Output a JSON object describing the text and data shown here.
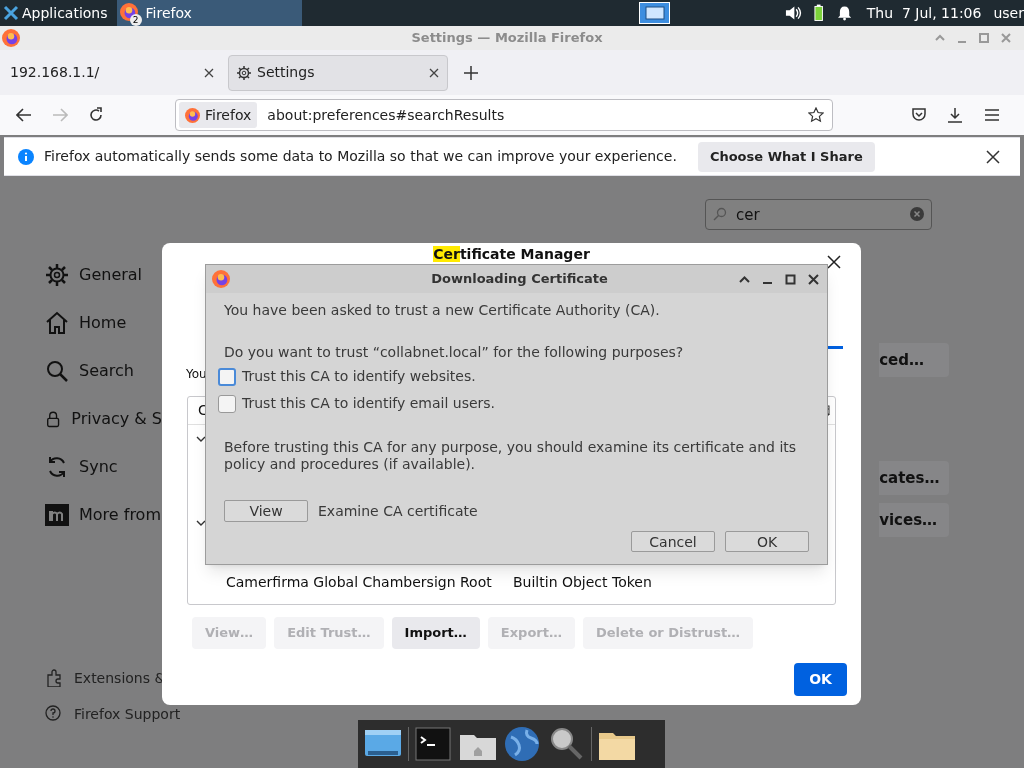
{
  "top_panel": {
    "apps_menu": "Applications",
    "task": {
      "label": "Firefox",
      "badge": "2"
    },
    "clock": "Thu  7 Jul, 11:06",
    "user": "user"
  },
  "window": {
    "title": "Settings — Mozilla Firefox"
  },
  "tabs": [
    {
      "label": "192.168.1.1/",
      "selected": false
    },
    {
      "label": "Settings",
      "selected": true
    }
  ],
  "address_bar": {
    "identity": "Firefox",
    "url": "about:preferences#searchResults"
  },
  "notification": {
    "text": "Firefox automatically sends some data to Mozilla so that we can improve your experience.",
    "button": "Choose What I Share"
  },
  "settings_search": {
    "value": "cer"
  },
  "sidebar": {
    "items": [
      {
        "label": "General"
      },
      {
        "label": "Home"
      },
      {
        "label": "Search"
      },
      {
        "label": "Privacy & S"
      },
      {
        "label": "Sync"
      },
      {
        "label": "More from"
      }
    ],
    "footer_links": [
      "Extensions &",
      "Firefox Support"
    ]
  },
  "page_buttons": [
    "ced…",
    "cates…",
    "vices…"
  ],
  "cert_manager": {
    "title": [
      {
        "text": "Cer",
        "highlighted": true
      },
      {
        "text": "tificate Manager",
        "highlighted": false
      }
    ],
    "intro": "You",
    "table": {
      "columns": [
        "C"
      ],
      "rows": [
        {
          "kind": "group",
          "expanded": true
        },
        {
          "kind": "group",
          "expanded": true
        },
        {
          "kind": "cert",
          "name": "Camerfirma Global Chambersign Root",
          "device": "Builtin Object Token"
        }
      ]
    },
    "buttons": [
      {
        "label": "View…",
        "disabled": true
      },
      {
        "label": "Edit Trust…",
        "disabled": true
      },
      {
        "label": "Import…",
        "disabled": false
      },
      {
        "label": "Export…",
        "disabled": true
      },
      {
        "label": "Delete or Distrust…",
        "disabled": true
      }
    ],
    "ok": "OK"
  },
  "download_dialog": {
    "title": "Downloading Certificate",
    "message": "You have been asked to trust a new Certificate Authority (CA).",
    "question": "Do you want to trust “collabnet.local” for the following purposes?",
    "options": [
      {
        "label": "Trust this CA to identify websites.",
        "checked": false,
        "focused": true
      },
      {
        "label": "Trust this CA to identify email users.",
        "checked": false,
        "focused": false
      }
    ],
    "warning": "Before trusting this CA for any purpose, you should examine its certificate and its policy and procedures (if available).",
    "view_button": "View",
    "view_hint": "Examine CA certificate",
    "buttons": [
      "Cancel",
      "OK"
    ]
  }
}
